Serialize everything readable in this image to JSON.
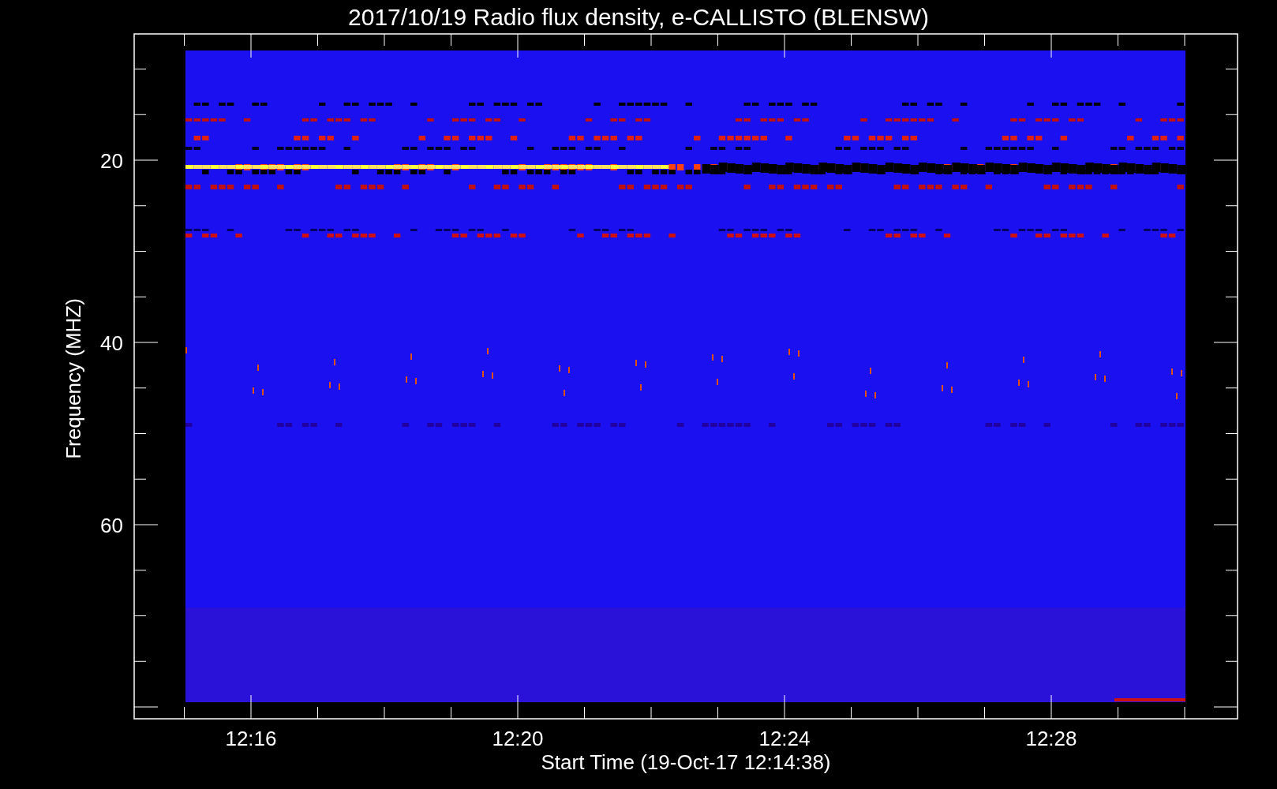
{
  "plot": {
    "title": "2017/10/19  Radio flux density, e-CALLISTO (BLENSW)",
    "ylabel": "Frequency (MHZ)",
    "xlabel": "Start Time (19-Oct-17 12:14:38)",
    "yticks": [
      "20",
      "40",
      "60"
    ],
    "xticks": [
      "12:16",
      "12:20",
      "12:24",
      "12:28"
    ]
  }
}
